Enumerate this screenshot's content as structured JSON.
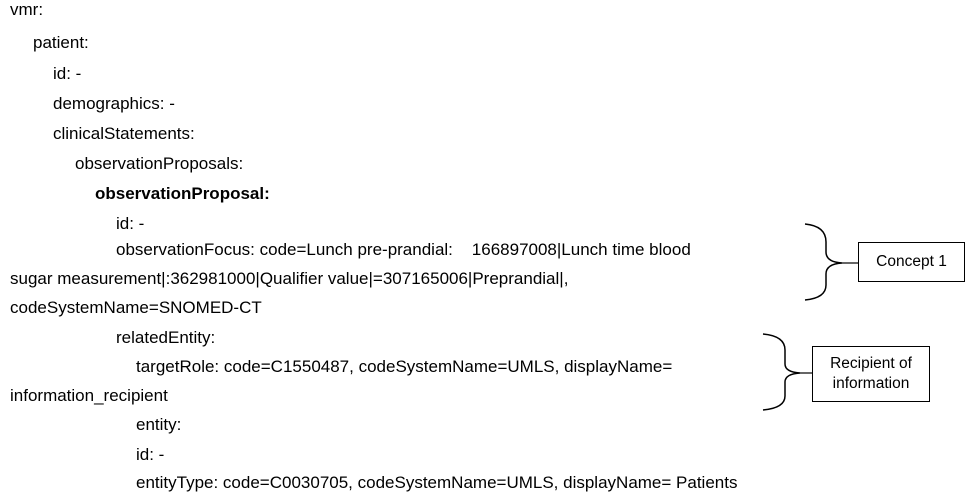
{
  "lines": [
    {
      "text": "vmr:"
    },
    {
      "text": "patient:"
    },
    {
      "text": "id: -"
    },
    {
      "text": "demographics: -"
    },
    {
      "text": "clinicalStatements:"
    },
    {
      "text": "observationProposals:"
    },
    {
      "text": "observationProposal:"
    },
    {
      "text": "id: -"
    },
    {
      "text": "observationFocus: code=Lunch pre-prandial:    166897008|Lunch time blood"
    },
    {
      "text": "sugar measurement|:362981000|Qualifier value|=307165006|Preprandial|,"
    },
    {
      "text": "codeSystemName=SNOMED-CT"
    },
    {
      "text": "relatedEntity:"
    },
    {
      "text": "targetRole: code=C1550487, codeSystemName=UMLS, displayName="
    },
    {
      "text": "information_recipient"
    },
    {
      "text": "entity:"
    },
    {
      "text": "id: -"
    },
    {
      "text": "entityType: code=C0030705, codeSystemName=UMLS, displayName= Patients"
    }
  ],
  "annotations": {
    "concept1": "Concept 1",
    "recipient_line1": "Recipient of",
    "recipient_line2": "information"
  }
}
